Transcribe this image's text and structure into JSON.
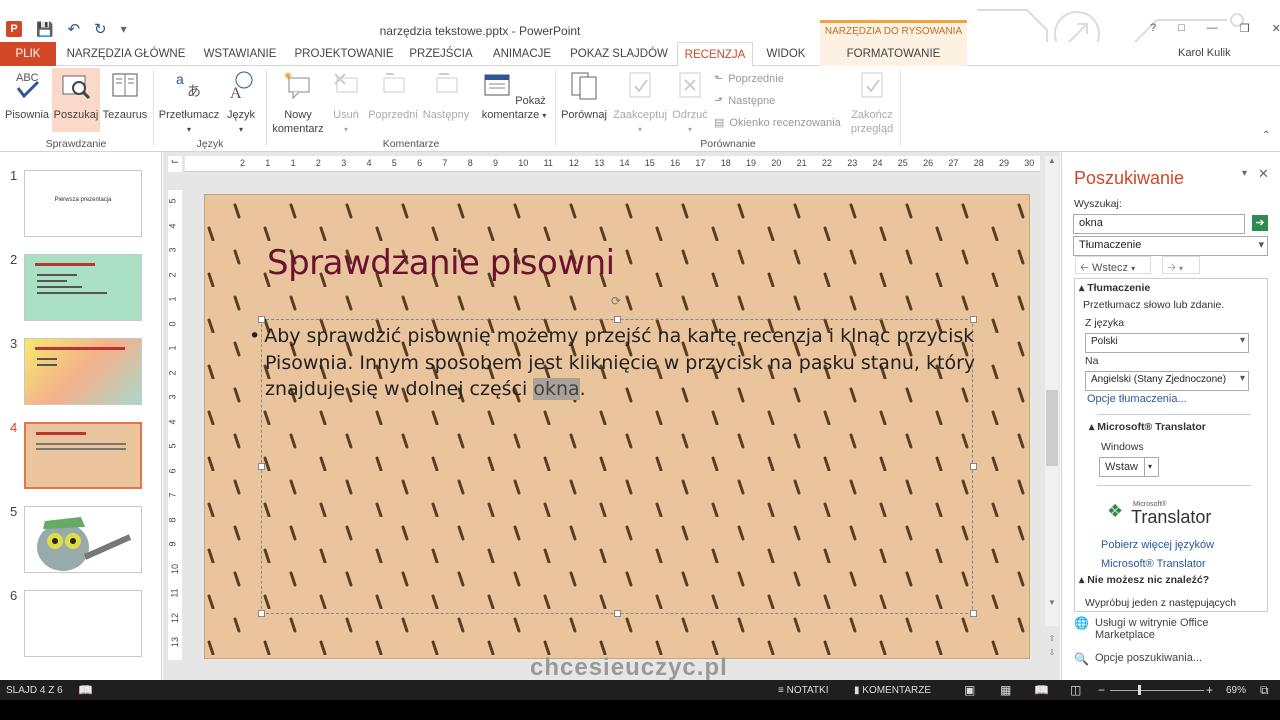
{
  "title_bar": {
    "document_title": "narzędzia tekstowe.pptx - PowerPoint",
    "context_header": "NARZĘDZIA DO RYSOWANIA",
    "window_help": "?",
    "user": "Karol Kulik"
  },
  "tabs": [
    "PLIK",
    "NARZĘDZIA GŁÓWNE",
    "WSTAWIANIE",
    "PROJEKTOWANIE",
    "PRZEJŚCIA",
    "ANIMACJE",
    "POKAZ SLAJDÓW",
    "RECENZJA",
    "WIDOK",
    "FORMATOWANIE"
  ],
  "ribbon": {
    "pisownia": "Pisownia",
    "poszukaj": "Poszukaj",
    "tezaurus": "Tezaurus",
    "group_sprawdzanie": "Sprawdzanie",
    "przetlumacz": "Przetłumacz",
    "jezyk": "Język",
    "group_jezyk": "Język",
    "nowy_komentarz_1": "Nowy",
    "nowy_komentarz_2": "komentarz",
    "usun": "Usuń",
    "poprzedni": "Poprzedni",
    "nastepny": "Następny",
    "pokaz_kom_1": "Pokaż",
    "pokaz_kom_2": "komentarze",
    "group_komentarze": "Komentarze",
    "porownaj": "Porównaj",
    "zaakceptuj": "Zaakceptuj",
    "odrzuc": "Odrzuć",
    "poprzednie": "Poprzednie",
    "nastepne": "Następne",
    "okienko": "Okienko recenzowania",
    "zakoncz_1": "Zakończ",
    "zakoncz_2": "przegląd",
    "group_porownanie": "Porównanie"
  },
  "thumbnails": {
    "numbers": [
      "1",
      "2",
      "3",
      "4",
      "5",
      "6"
    ],
    "slide1_title": "Pierwsza prezentacja"
  },
  "ruler": {
    "h_ticks": [
      "2",
      "1",
      "1",
      "2",
      "3",
      "4",
      "5",
      "6",
      "7",
      "8",
      "9",
      "10",
      "11",
      "12",
      "13",
      "14",
      "15",
      "16",
      "17",
      "18",
      "19",
      "20",
      "21",
      "22",
      "23",
      "24",
      "25",
      "26",
      "27",
      "28",
      "29",
      "30",
      "31"
    ],
    "v_ticks": [
      "5",
      "4",
      "3",
      "2",
      "1",
      "0",
      "1",
      "2",
      "3",
      "4",
      "5",
      "6",
      "7",
      "8",
      "9",
      "10",
      "11",
      "12",
      "13"
    ]
  },
  "slide": {
    "title": "Sprawdzanie pisowni",
    "body_before": "Aby sprawdzić pisownię możemy przejść na kartę recenzja i klnąc przycisk Pisownia. Innym sposobem jest kliknięcie w przycisk na pasku stanu, który znajduje się w dolnej części ",
    "body_selected": "okna",
    "body_after": "."
  },
  "watermark": "chcesieuczyc.pl",
  "pane": {
    "title": "Poszukiwanie",
    "search_label": "Wyszukaj:",
    "search_value": "okna",
    "service": "Tłumaczenie",
    "back": "Wstecz",
    "section_translation": "Tłumaczenie",
    "translate_hint": "Przetłumacz słowo lub zdanie.",
    "from_label": "Z języka",
    "from_value": "Polski",
    "to_label": "Na",
    "to_value": "Angielski (Stany Zjednoczone)",
    "options_link": "Opcje tłumaczenia...",
    "ms_translator": "Microsoft® Translator",
    "windows": "Windows",
    "insert": "Wstaw",
    "logo_small": "Microsoft®",
    "logo_big": "Translator",
    "more_langs": "Pobierz więcej języków",
    "ms_translator_link": "Microsoft® Translator",
    "not_found": "Nie możesz nic znaleźć?",
    "try_one": "Wypróbuj jeden z następujących",
    "office_marketplace_1": "Usługi w witrynie Office",
    "office_marketplace_2": "Marketplace",
    "search_options": "Opcje poszukiwania..."
  },
  "status_bar": {
    "slide_info": "SLAJD 4 Z 6",
    "notes": "NOTATKI",
    "comments": "KOMENTARZE",
    "zoom": "69%"
  },
  "colors": {
    "accent": "#d24726",
    "title": "#6a1230",
    "slide_bg": "#e9c49c"
  }
}
